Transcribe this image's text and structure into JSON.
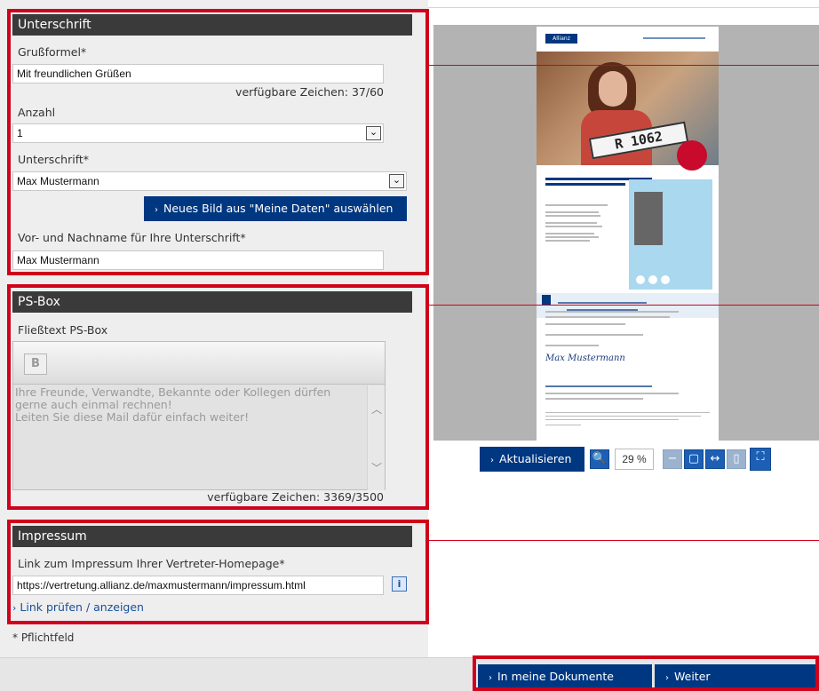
{
  "unterschrift": {
    "title": "Unterschrift",
    "grussformel_label": "Grußformel*",
    "grussformel_value": "Mit freundlichen Grüßen",
    "grussformel_counter": "verfügbare Zeichen: 37/60",
    "anzahl_label": "Anzahl",
    "anzahl_value": "1",
    "unterschrift_label": "Unterschrift*",
    "unterschrift_value": "Max Mustermann",
    "new_image_button": "Neues Bild aus \"Meine Daten\" auswählen",
    "name_label": "Vor- und Nachname für Ihre Unterschrift*",
    "name_value": "Max Mustermann"
  },
  "psbox": {
    "title": "PS-Box",
    "text_label": "Fließtext PS-Box",
    "bold_label": "B",
    "line1": "Ihre Freunde, Verwandte, Bekannte oder Kollegen dürfen",
    "line2": "gerne auch einmal rechnen!",
    "line3": "Leiten Sie diese Mail dafür einfach weiter!",
    "counter": "verfügbare Zeichen: 3369/3500"
  },
  "impressum": {
    "title": "Impressum",
    "link_label": "Link zum Impressum Ihrer Vertreter-Homepage*",
    "link_value": "https://vertretung.allianz.de/maxmustermann/impressum.html",
    "info_icon": "i",
    "check_link": "Link prüfen / anzeigen"
  },
  "footnote": "* Pflichtfeld",
  "preview": {
    "refresh_button": "Aktualisieren",
    "zoom_value": "29 %",
    "doc_logo": "Allianz",
    "doc_plate": "R 1062",
    "doc_signature": "Max Mustermann"
  },
  "footer": {
    "documents_button": "In meine Dokumente",
    "next_button": "Weiter"
  },
  "colors": {
    "accent_red": "#d0021b",
    "allianz_blue": "#003781",
    "header_dark": "#3a3a3a"
  }
}
